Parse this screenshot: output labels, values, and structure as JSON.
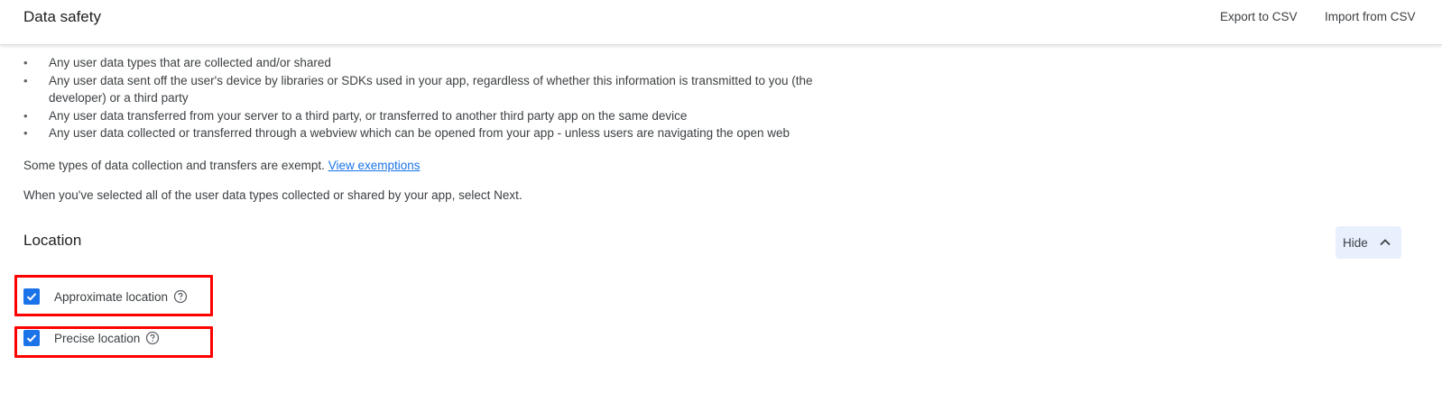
{
  "header": {
    "title": "Data safety",
    "export_label": "Export to CSV",
    "import_label": "Import from CSV"
  },
  "intro": {
    "bullets": [
      "Any user data types that are collected and/or shared",
      "Any user data sent off the user's device by libraries or SDKs used in your app, regardless of whether this information is transmitted to you (the developer) or a third party",
      "Any user data transferred from your server to a third party, or transferred to another third party app on the same device",
      "Any user data collected or transferred through a webview which can be opened from your app - unless users are navigating the open web"
    ],
    "exempt_text": "Some types of data collection and transfers are exempt. ",
    "exempt_link": "View exemptions",
    "next_text": "When you've selected all of the user data types collected or shared by your app, select Next."
  },
  "location": {
    "title": "Location",
    "hide_label": "Hide",
    "hide_icon": "chevron-up-icon",
    "items": [
      {
        "label": "Approximate location",
        "checked": true,
        "help_icon": "help-circle-icon"
      },
      {
        "label": "Precise location",
        "checked": true,
        "help_icon": "help-circle-icon"
      }
    ]
  },
  "colors": {
    "accent": "#1a73e8",
    "hide_button_bg": "#e8f0fe",
    "highlight": "#ff0000"
  }
}
